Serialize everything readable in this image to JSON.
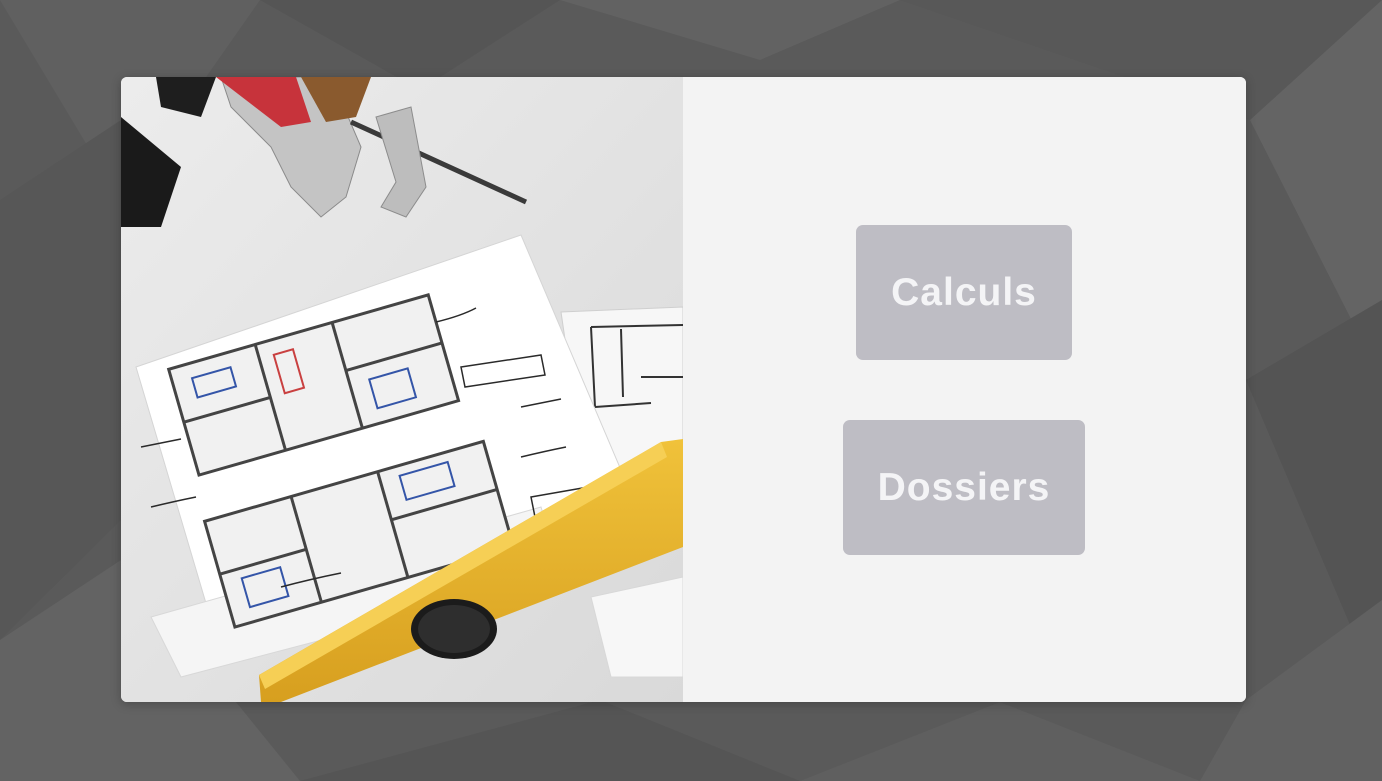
{
  "buttons": {
    "calculs_label": "Calculs",
    "dossiers_label": "Dossiers"
  },
  "colors": {
    "page_background": "#5c5c5c",
    "panel_background": "#f3f3f3",
    "button_background": "#bebdc4",
    "button_text": "#f4f4f6",
    "level_yellow": "#e8b52e"
  },
  "icons": {
    "photo": "architectural-floor-plan-with-tools-photo"
  }
}
